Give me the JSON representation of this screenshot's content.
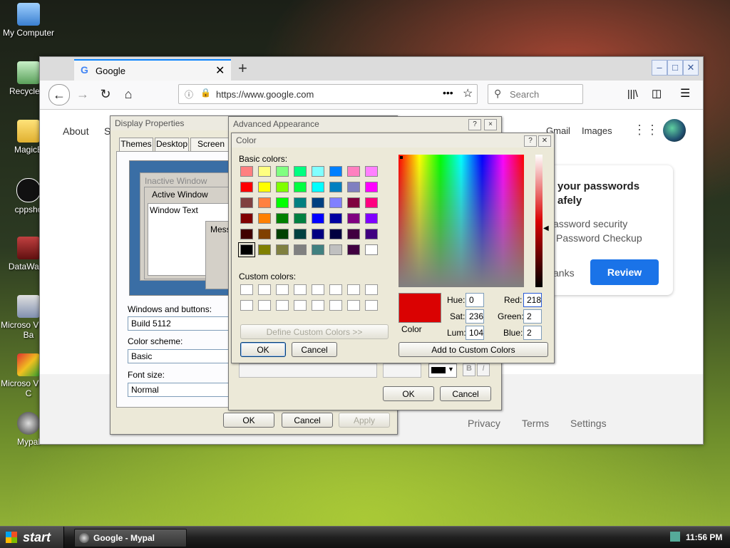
{
  "desktop": {
    "icons": [
      {
        "label": "My Computer",
        "icon": "computer-icon"
      },
      {
        "label": "Recycle B",
        "icon": "recycle-bin-icon"
      },
      {
        "label": "MagicB",
        "icon": "folder-icon"
      },
      {
        "label": "cppsho",
        "icon": "cpp-icon"
      },
      {
        "label": "DataWage",
        "icon": "datawage-icon"
      },
      {
        "label": "Microso Visual Ba",
        "icon": "vb-icon"
      },
      {
        "label": "Microso Visual C",
        "icon": "vc-icon"
      },
      {
        "label": "Mypal",
        "icon": "mypal-icon"
      }
    ]
  },
  "browser": {
    "tab_title": "Google",
    "url": "https://www.google.com",
    "search_placeholder": "Search",
    "page": {
      "nav_left": [
        "About",
        "S"
      ],
      "nav_right": [
        "Gmail",
        "Images"
      ],
      "card_title": "your passwords afely",
      "card_line1": "assword security",
      "card_line2": "Password Checkup",
      "card_thanks": "anks",
      "card_review": "Review",
      "footer": [
        "Privacy",
        "Terms",
        "Settings"
      ]
    }
  },
  "display_properties": {
    "title": "Display Properties",
    "tabs": [
      "Themes",
      "Desktop",
      "Screen Sa"
    ],
    "preview": {
      "inactive": "Inactive Window",
      "active": "Active Window",
      "window_text": "Window Text",
      "message": "Messa"
    },
    "windows_buttons_label": "Windows and buttons:",
    "windows_buttons_value": "Build 5112",
    "color_scheme_label": "Color scheme:",
    "color_scheme_value": "Basic",
    "font_size_label": "Font size:",
    "font_size_value": "Normal",
    "ok": "OK",
    "cancel": "Cancel",
    "apply": "Apply"
  },
  "advanced_appearance": {
    "title": "Advanced Appearance",
    "ok": "OK",
    "cancel": "Cancel",
    "help": "?",
    "close": "×"
  },
  "color_dialog": {
    "title": "Color",
    "basic_colors_label": "Basic colors:",
    "custom_colors_label": "Custom colors:",
    "define_custom": "Define Custom Colors >>",
    "ok": "OK",
    "cancel": "Cancel",
    "color_label": "Color",
    "hue_label": "Hue:",
    "hue": "0",
    "sat_label": "Sat:",
    "sat": "236",
    "lum_label": "Lum:",
    "lum": "104",
    "red_label": "Red:",
    "red": "218",
    "green_label": "Green:",
    "green": "2",
    "blue_label": "Blue:",
    "blue": "2",
    "add_custom": "Add to Custom Colors",
    "current_color": "#da0202",
    "basic_colors": [
      "#ff8080",
      "#ffff80",
      "#80ff80",
      "#00ff80",
      "#80ffff",
      "#0080ff",
      "#ff80c0",
      "#ff80ff",
      "#ff0000",
      "#ffff00",
      "#80ff00",
      "#00ff40",
      "#00ffff",
      "#0080c0",
      "#8080c0",
      "#ff00ff",
      "#804040",
      "#ff8040",
      "#00ff00",
      "#008080",
      "#004080",
      "#8080ff",
      "#800040",
      "#ff0080",
      "#800000",
      "#ff8000",
      "#008000",
      "#008040",
      "#0000ff",
      "#0000a0",
      "#800080",
      "#8000ff",
      "#400000",
      "#804000",
      "#004000",
      "#004040",
      "#000080",
      "#000040",
      "#400040",
      "#400080",
      "#000000",
      "#808000",
      "#808040",
      "#808080",
      "#408080",
      "#c0c0c0",
      "#400040",
      "#ffffff"
    ]
  },
  "taskbar": {
    "start": "start",
    "task": "Google - Mypal",
    "clock": "11:56 PM"
  }
}
